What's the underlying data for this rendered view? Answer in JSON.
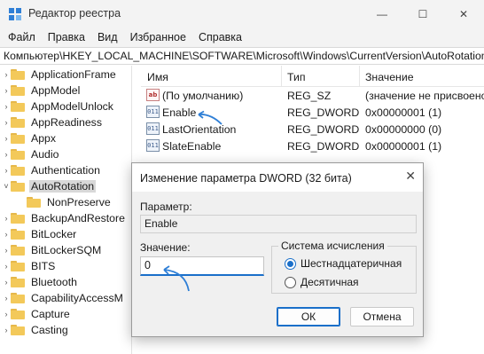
{
  "window": {
    "title": "Редактор реестра",
    "controls": {
      "minimize": "—",
      "maximize": "☐",
      "close": "✕"
    }
  },
  "menu": [
    "Файл",
    "Правка",
    "Вид",
    "Избранное",
    "Справка"
  ],
  "address": "Компьютер\\HKEY_LOCAL_MACHINE\\SOFTWARE\\Microsoft\\Windows\\CurrentVersion\\AutoRotation",
  "tree": {
    "items": [
      {
        "label": "ApplicationFrame",
        "expander": "›",
        "level": 0
      },
      {
        "label": "AppModel",
        "expander": "›",
        "level": 0
      },
      {
        "label": "AppModelUnlock",
        "expander": "›",
        "level": 0
      },
      {
        "label": "AppReadiness",
        "expander": "›",
        "level": 0
      },
      {
        "label": "Appx",
        "expander": "›",
        "level": 0
      },
      {
        "label": "Audio",
        "expander": "›",
        "level": 0
      },
      {
        "label": "Authentication",
        "expander": "›",
        "level": 0
      },
      {
        "label": "AutoRotation",
        "expander": "˅",
        "level": 0,
        "selected": true
      },
      {
        "label": "NonPreserve",
        "expander": "",
        "level": 1
      },
      {
        "label": "BackupAndRestore",
        "expander": "›",
        "level": 0
      },
      {
        "label": "BitLocker",
        "expander": "›",
        "level": 0
      },
      {
        "label": "BitLockerSQM",
        "expander": "›",
        "level": 0
      },
      {
        "label": "BITS",
        "expander": "›",
        "level": 0
      },
      {
        "label": "Bluetooth",
        "expander": "›",
        "level": 0
      },
      {
        "label": "CapabilityAccessM",
        "expander": "›",
        "level": 0
      },
      {
        "label": "Capture",
        "expander": "›",
        "level": 0
      },
      {
        "label": "Casting",
        "expander": "›",
        "level": 0
      }
    ]
  },
  "list": {
    "headers": {
      "name": "Имя",
      "type": "Тип",
      "data": "Значение"
    },
    "rows": [
      {
        "icon": "ab",
        "name": "(По умолчанию)",
        "type": "REG_SZ",
        "data": "(значение не присвоено)"
      },
      {
        "icon": "dword",
        "name": "Enable",
        "type": "REG_DWORD",
        "data": "0x00000001 (1)"
      },
      {
        "icon": "dword",
        "name": "LastOrientation",
        "type": "REG_DWORD",
        "data": "0x00000000 (0)"
      },
      {
        "icon": "dword",
        "name": "SlateEnable",
        "type": "REG_DWORD",
        "data": "0x00000001 (1)"
      }
    ],
    "icon_glyphs": {
      "ab": "ab",
      "dword": "011"
    }
  },
  "dialog": {
    "title": "Изменение параметра DWORD (32 бита)",
    "close": "✕",
    "param_label": "Параметр:",
    "param_value": "Enable",
    "value_label": "Значение:",
    "value": "0",
    "base_group": "Система исчисления",
    "radio_hex": "Шестнадцатеричная",
    "radio_dec": "Десятичная",
    "selected_base": "hex",
    "ok": "ОК",
    "cancel": "Отмена"
  },
  "colors": {
    "accent": "#1a6fc9",
    "folder": "#f3c95a",
    "annotation": "#2f7fd6"
  }
}
